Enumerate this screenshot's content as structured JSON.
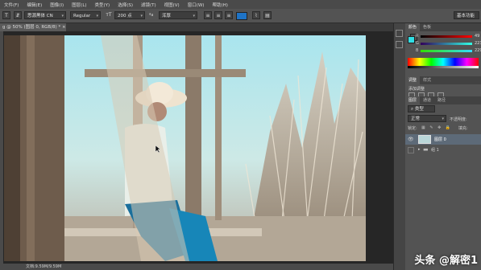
{
  "menubar": {
    "items": [
      "文件(F)",
      "编辑(E)",
      "图像(I)",
      "图层(L)",
      "类型(Y)",
      "选择(S)",
      "滤镜(T)",
      "视图(V)",
      "窗口(W)",
      "帮助(H)"
    ]
  },
  "options": {
    "font_family": "思源黑体 CN",
    "font_style": "Regular",
    "font_size": "200 点",
    "aa_label": "ªa",
    "aa_value": "浑厚",
    "workspace": "基本功能"
  },
  "document": {
    "tab_title": "g @ 50% (图层 0, RGB/8) * ×",
    "status": "文档:9.59M/9.59M"
  },
  "color_panel": {
    "tabs": [
      "颜色",
      "色板"
    ],
    "r_label": "R",
    "g_label": "G",
    "b_label": "B",
    "r_value": "49",
    "g_value": "223",
    "b_value": "229",
    "foreground": "#31dfe5",
    "background": "#ffffff"
  },
  "adjust_panel": {
    "tabs": [
      "调整",
      "样式"
    ],
    "title": "添加调整"
  },
  "layers_panel": {
    "tabs": [
      "图层",
      "通道",
      "路径"
    ],
    "kind": "类型",
    "blend_mode": "正常",
    "opacity_label": "不透明度:",
    "lock_label": "锁定:",
    "fill_label": "填充:",
    "layers": [
      {
        "name": "图层 0"
      },
      {
        "name": "组 1"
      }
    ]
  },
  "watermark": "头条 @解密1"
}
